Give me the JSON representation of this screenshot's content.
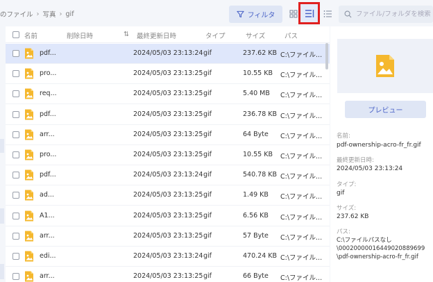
{
  "breadcrumb": [
    "のファイル",
    "写真",
    "gif"
  ],
  "toolbar": {
    "filter_label": "フィルタ",
    "search_placeholder": "ファイル/フォルダを検索"
  },
  "table": {
    "columns": [
      "名前",
      "削除日時",
      "最終更新日時",
      "タイプ",
      "サイズ",
      "パス"
    ],
    "rows": [
      {
        "name": "pdf...",
        "modified": "2024/05/03 23:13:24",
        "type": "gif",
        "size": "237.62 KB",
        "path": "C:\\ファイル...",
        "selected": true
      },
      {
        "name": "pro...",
        "modified": "2024/05/03 23:13:25",
        "type": "gif",
        "size": "10.55 KB",
        "path": "C:\\ファイル..."
      },
      {
        "name": "req...",
        "modified": "2024/05/03 23:13:25",
        "type": "gif",
        "size": "5.40 MB",
        "path": "C:\\ファイル..."
      },
      {
        "name": "pdf...",
        "modified": "2024/05/03 23:13:25",
        "type": "gif",
        "size": "236.78 KB",
        "path": "C:\\ファイル..."
      },
      {
        "name": "arr...",
        "modified": "2024/05/03 23:13:25",
        "type": "gif",
        "size": "64 Byte",
        "path": "C:\\ファイル..."
      },
      {
        "name": "pro...",
        "modified": "2024/05/03 23:13:25",
        "type": "gif",
        "size": "10.55 KB",
        "path": "C:\\ファイル..."
      },
      {
        "name": "pdf...",
        "modified": "2024/05/03 23:13:24",
        "type": "gif",
        "size": "540.78 KB",
        "path": "C:\\ファイル..."
      },
      {
        "name": "ad...",
        "modified": "2024/05/03 23:13:25",
        "type": "gif",
        "size": "1.49 KB",
        "path": "C:\\ファイル..."
      },
      {
        "name": "A1...",
        "modified": "2024/05/03 23:13:25",
        "type": "gif",
        "size": "6.56 KB",
        "path": "C:\\ファイル..."
      },
      {
        "name": "arr...",
        "modified": "2024/05/03 23:13:25",
        "type": "gif",
        "size": "57 Byte",
        "path": "C:\\ファイル..."
      },
      {
        "name": "edi...",
        "modified": "2024/05/03 23:13:24",
        "type": "gif",
        "size": "470.24 KB",
        "path": "C:\\ファイル..."
      },
      {
        "name": "arr...",
        "modified": "2024/05/03 23:13:25",
        "type": "gif",
        "size": "66 Byte",
        "path": "C:\\ファイル..."
      }
    ]
  },
  "preview": {
    "button_label": "プレビュー",
    "name_label": "名前:",
    "name_value": "pdf-ownership-acro-fr_fr.gif",
    "modified_label": "最終更新日時:",
    "modified_value": "2024/05/03 23:13:24",
    "type_label": "タイプ:",
    "type_value": "gif",
    "size_label": "サイズ:",
    "size_value": "237.62 KB",
    "path_label": "パス:",
    "path_line1": "C:\\ファイルパスなし",
    "path_line2": "\\00020000016449020889699",
    "path_line3": "\\pdf-ownership-acro-fr_fr.gif"
  },
  "colors": {
    "accent": "#4a63c7",
    "highlight_box": "#e02020",
    "selected_row": "#dfe7fb",
    "file_icon": "#f5b82e"
  },
  "icons": {
    "filter": "funnel-icon",
    "grid_view": "grid-view-icon",
    "detail_view": "detail-view-icon",
    "list_view": "list-view-icon",
    "search": "search-icon",
    "sort": "sort-icon",
    "file": "image-file-icon"
  }
}
